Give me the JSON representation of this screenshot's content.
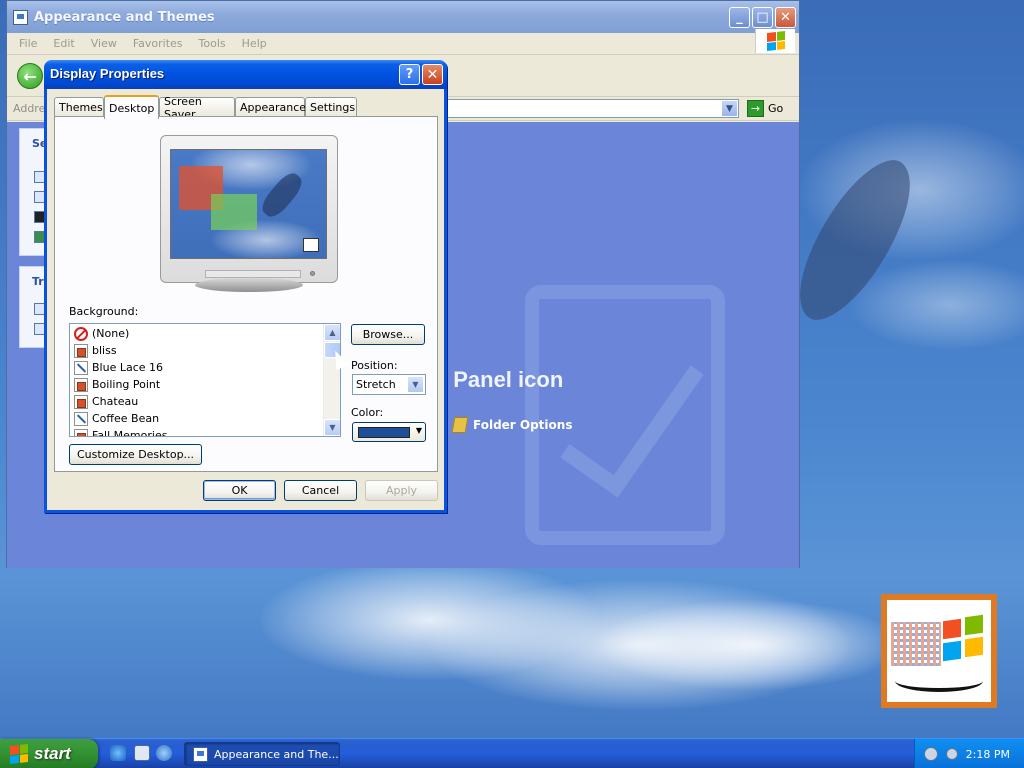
{
  "explorer": {
    "title": "Appearance and Themes",
    "menu": [
      "File",
      "Edit",
      "View",
      "Favorites",
      "Tools",
      "Help"
    ],
    "address_label": "Address",
    "go_label": "Go",
    "left_panels": [
      {
        "title": "Se"
      },
      {
        "title": "Tr"
      }
    ],
    "heading": "l Panel icon",
    "folder_options": "Folder Options"
  },
  "dialog": {
    "title": "Display Properties",
    "tabs": [
      "Themes",
      "Desktop",
      "Screen Saver",
      "Appearance",
      "Settings"
    ],
    "active_tab": "Desktop",
    "background_label": "Background:",
    "backgrounds": [
      {
        "name": "(None)",
        "icon": "none-icon"
      },
      {
        "name": "bliss",
        "icon": "bitmap-icon"
      },
      {
        "name": "Blue Lace 16",
        "icon": "html-icon"
      },
      {
        "name": "Boiling Point",
        "icon": "bitmap-icon"
      },
      {
        "name": "Chateau",
        "icon": "bitmap-icon"
      },
      {
        "name": "Coffee Bean",
        "icon": "html-icon"
      },
      {
        "name": "Fall Memories",
        "icon": "bitmap-icon"
      }
    ],
    "browse_label": "Browse...",
    "position_label": "Position:",
    "position_value": "Stretch",
    "color_label": "Color:",
    "color_value": "#1c4f98",
    "customize_label": "Customize Desktop...",
    "ok_label": "OK",
    "cancel_label": "Cancel",
    "apply_label": "Apply"
  },
  "taskbar": {
    "start_label": "start",
    "task_label": "Appearance and The...",
    "clock": "2:18 PM"
  }
}
